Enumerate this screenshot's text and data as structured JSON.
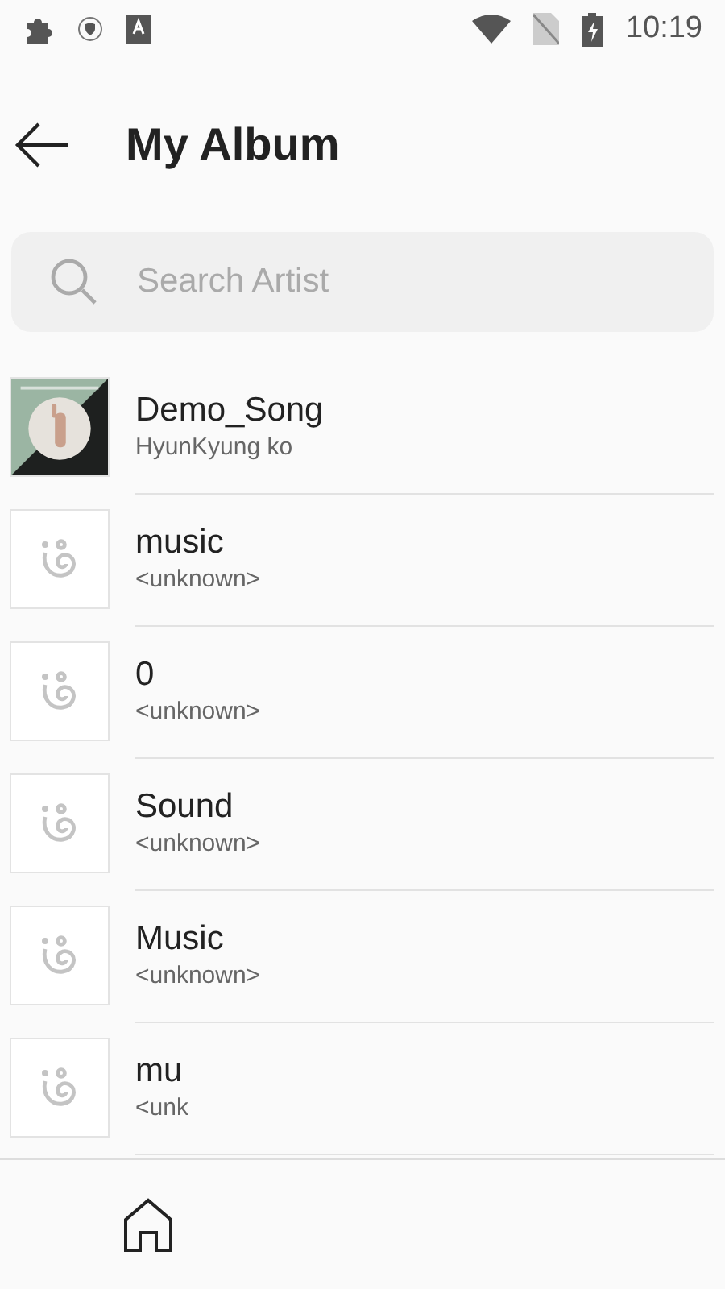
{
  "status_bar": {
    "time": "10:19"
  },
  "header": {
    "title": "My Album"
  },
  "search": {
    "placeholder": "Search Artist"
  },
  "albums": [
    {
      "kind": "picture",
      "title": "Demo_Song",
      "artist": "HyunKyung ko"
    },
    {
      "kind": "placeholder",
      "title": "music",
      "artist": "<unknown>"
    },
    {
      "kind": "placeholder",
      "title": "0",
      "artist": "<unknown>"
    },
    {
      "kind": "placeholder",
      "title": "Sound",
      "artist": "<unknown>"
    },
    {
      "kind": "placeholder",
      "title": "Music",
      "artist": "<unknown>"
    },
    {
      "kind": "placeholder",
      "title": "mu",
      "artist": "<unk"
    }
  ],
  "bottom_nav": {
    "items": [
      {
        "kind": "home"
      }
    ]
  }
}
